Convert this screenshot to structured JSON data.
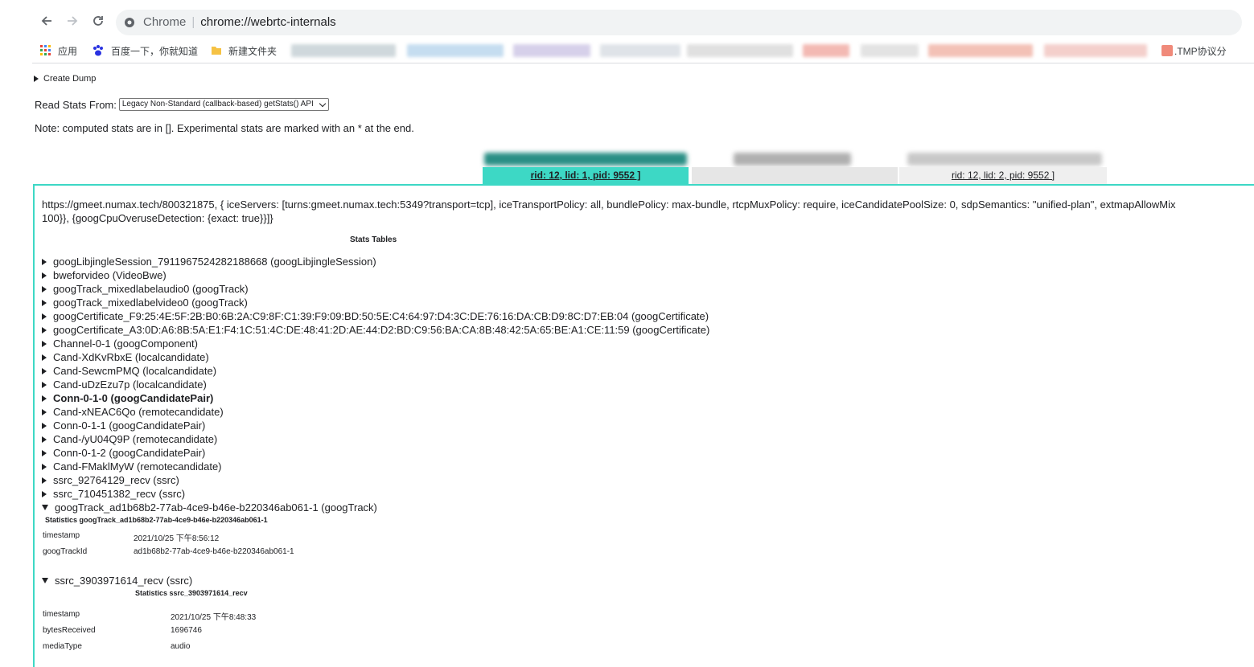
{
  "browser": {
    "omnibox": {
      "label": "Chrome",
      "url": "chrome://webrtc-internals"
    },
    "bookmarks": [
      {
        "label": "应用",
        "icon": "apps-grid-icon"
      },
      {
        "label": "百度一下，你就知道",
        "icon": "baidu-paw-icon"
      },
      {
        "label": "新建文件夹",
        "icon": "folder-icon"
      },
      {
        "label": ".TMP协议分",
        "icon": "favicon"
      }
    ]
  },
  "page": {
    "create_dump": "Create Dump",
    "read_stats_label": "Read Stats From:",
    "read_stats_value": "Legacy Non-Standard (callback-based) getStats() API",
    "note": "Note: computed stats are in []. Experimental stats are marked with an * at the end.",
    "tabs": [
      {
        "label": "rid: 12, lid: 1, pid: 9552 ]",
        "active": true
      },
      {
        "label": "",
        "active": false
      },
      {
        "label": "rid: 12, lid: 2, pid: 9552 ]",
        "active": false
      }
    ],
    "connection_line1": "https://gmeet.numax.tech/800321875, { iceServers: [turns:gmeet.numax.tech:5349?transport=tcp], iceTransportPolicy: all, bundlePolicy: max-bundle, rtcpMuxPolicy: require, iceCandidatePoolSize: 0, sdpSemantics: \"unified-plan\", extmapAllowMix",
    "connection_line2": "100}}, {googCpuOveruseDetection: {exact: true}}]}",
    "stats_heading": "Stats Tables",
    "tree": [
      {
        "label": "googLibjingleSession_7911967524282188668 (googLibjingleSession)"
      },
      {
        "label": "bweforvideo (VideoBwe)"
      },
      {
        "label": "googTrack_mixedlabelaudio0 (googTrack)"
      },
      {
        "label": "googTrack_mixedlabelvideo0 (googTrack)"
      },
      {
        "label": "googCertificate_F9:25:4E:5F:2B:B0:6B:2A:C9:8F:C1:39:F9:09:BD:50:5E:C4:64:97:D4:3C:DE:76:16:DA:CB:D9:8C:D7:EB:04 (googCertificate)"
      },
      {
        "label": "googCertificate_A3:0D:A6:8B:5A:E1:F4:1C:51:4C:DE:48:41:2D:AE:44:D2:BD:C9:56:BA:CA:8B:48:42:5A:65:BE:A1:CE:11:59 (googCertificate)"
      },
      {
        "label": "Channel-0-1 (googComponent)"
      },
      {
        "label": "Cand-XdKvRbxE (localcandidate)"
      },
      {
        "label": "Cand-SewcmPMQ (localcandidate)"
      },
      {
        "label": "Cand-uDzEzu7p (localcandidate)"
      },
      {
        "label": "Conn-0-1-0 (googCandidatePair)",
        "bold": true
      },
      {
        "label": "Cand-xNEAC6Qo (remotecandidate)"
      },
      {
        "label": "Conn-0-1-1 (googCandidatePair)"
      },
      {
        "label": "Cand-/yU04Q9P (remotecandidate)"
      },
      {
        "label": "Conn-0-1-2 (googCandidatePair)"
      },
      {
        "label": "Cand-FMaklMyW (remotecandidate)"
      },
      {
        "label": "ssrc_92764129_recv (ssrc)"
      },
      {
        "label": "ssrc_710451382_recv (ssrc)"
      },
      {
        "label": "googTrack_ad1b68b2-77ab-4ce9-b46e-b220346ab061-1 (googTrack)",
        "expanded": true
      }
    ],
    "expanded1": {
      "caption": "Statistics googTrack_ad1b68b2-77ab-4ce9-b46e-b220346ab061-1",
      "rows": [
        {
          "key": "timestamp",
          "value": "2021/10/25 下午8:56:12"
        },
        {
          "key": "googTrackId",
          "value": "ad1b68b2-77ab-4ce9-b46e-b220346ab061-1"
        }
      ]
    },
    "tree2": {
      "label": "ssrc_3903971614_recv (ssrc)"
    },
    "expanded2": {
      "caption": "Statistics ssrc_3903971614_recv",
      "rows": [
        {
          "key": "timestamp",
          "value": "2021/10/25 下午8:48:33"
        },
        {
          "key": "bytesReceived",
          "value": "1696746"
        },
        {
          "key": "mediaType",
          "value": "audio"
        }
      ]
    },
    "colors": {
      "accent": "#3dd8c5",
      "blur_tab": "#2a9d8f"
    }
  }
}
